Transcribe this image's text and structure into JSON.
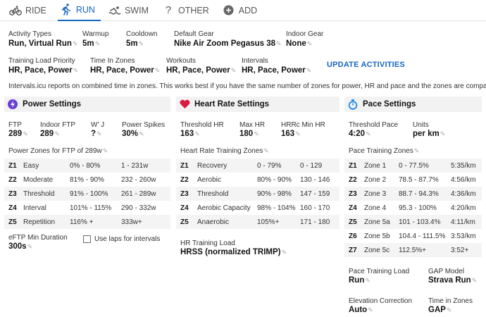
{
  "tabs": [
    {
      "label": "RIDE",
      "icon": "bike-icon"
    },
    {
      "label": "RUN",
      "icon": "run-icon",
      "active": true
    },
    {
      "label": "SWIM",
      "icon": "swim-icon"
    },
    {
      "label": "OTHER",
      "icon": "question-icon"
    },
    {
      "label": "ADD",
      "icon": "plus-circle-icon"
    }
  ],
  "settings": {
    "activity_types": {
      "label": "Activity Types",
      "value": "Run, Virtual Run"
    },
    "warmup": {
      "label": "Warmup",
      "value": "5m"
    },
    "cooldown": {
      "label": "Cooldown",
      "value": "5m"
    },
    "default_gear": {
      "label": "Default Gear",
      "value": "Nike Air Zoom Pegasus 38"
    },
    "indoor_gear": {
      "label": "Indoor Gear",
      "value": "None"
    },
    "training_load_priority": {
      "label": "Training Load Priority",
      "value": "HR, Pace, Power"
    },
    "time_in_zones": {
      "label": "Time In Zones",
      "value": "HR, Pace, Power"
    },
    "workouts": {
      "label": "Workouts",
      "value": "HR, Pace, Power"
    },
    "intervals": {
      "label": "Intervals",
      "value": "HR, Pace, Power"
    },
    "update_link": "UPDATE ACTIVITIES",
    "note": "Intervals.icu reports on combined time in zones. This works best if you have the same number of zones for power, HR and pace and the zones are comparable."
  },
  "power": {
    "title": "Power Settings",
    "accent": "#6a3fd0",
    "ftp": {
      "label": "FTP",
      "value": "289"
    },
    "indoor_ftp": {
      "label": "Indoor FTP",
      "value": "289"
    },
    "wj": {
      "label": "W' J",
      "value": "?"
    },
    "spikes": {
      "label": "Power Spikes",
      "value": "30%"
    },
    "zones_title": "Power Zones for FTP of 289w",
    "zones": [
      {
        "code": "Z1",
        "name": "Easy",
        "pct": "0% - 80%",
        "range": "1 - 231w"
      },
      {
        "code": "Z2",
        "name": "Moderate",
        "pct": "81% - 90%",
        "range": "232 - 260w"
      },
      {
        "code": "Z3",
        "name": "Threshold",
        "pct": "91% - 100%",
        "range": "261 - 289w"
      },
      {
        "code": "Z4",
        "name": "Interval",
        "pct": "101% - 115%",
        "range": "290 - 332w"
      },
      {
        "code": "Z5",
        "name": "Repetition",
        "pct": "116% +",
        "range": "333w+"
      }
    ],
    "eftp": {
      "label": "eFTP Min Duration",
      "value": "300s"
    },
    "use_laps": "Use laps for intervals"
  },
  "hr": {
    "title": "Heart Rate Settings",
    "accent": "#d81b3f",
    "threshold": {
      "label": "Threshold HR",
      "value": "163"
    },
    "max": {
      "label": "Max HR",
      "value": "180"
    },
    "hrrc": {
      "label": "HRRc Min HR",
      "value": "163"
    },
    "zones_title": "Heart Rate Training Zones",
    "zones": [
      {
        "code": "Z1",
        "name": "Recovery",
        "pct": "0 - 79%",
        "range": "0 - 129"
      },
      {
        "code": "Z2",
        "name": "Aerobic",
        "pct": "80% - 90%",
        "range": "130 - 146"
      },
      {
        "code": "Z3",
        "name": "Threshold",
        "pct": "90% - 98%",
        "range": "147 - 159"
      },
      {
        "code": "Z4",
        "name": "Aerobic Capacity",
        "pct": "98% - 104%",
        "range": "160 - 170"
      },
      {
        "code": "Z5",
        "name": "Anaerobic",
        "pct": "105%+",
        "range": "171 - 180"
      }
    ],
    "load": {
      "label": "HR Training Load",
      "value": "HRSS (normalized TRIMP)"
    }
  },
  "pace": {
    "title": "Pace Settings",
    "accent": "#1e88e5",
    "threshold": {
      "label": "Threshold Pace",
      "value": "4:20"
    },
    "units": {
      "label": "Units",
      "value": "per km"
    },
    "zones_title": "Pace Training Zones",
    "zones": [
      {
        "code": "Z1",
        "name": "Zone 1",
        "pct": "0 - 77.5%",
        "range": "5:35/km"
      },
      {
        "code": "Z2",
        "name": "Zone 2",
        "pct": "78.5 - 87.7%",
        "range": "4:56/km"
      },
      {
        "code": "Z3",
        "name": "Zone 3",
        "pct": "88.7 - 94.3%",
        "range": "4:36/km"
      },
      {
        "code": "Z4",
        "name": "Zone 4",
        "pct": "95.3 - 100%",
        "range": "4:20/km"
      },
      {
        "code": "Z5",
        "name": "Zone 5a",
        "pct": "101 - 103.4%",
        "range": "4:11/km"
      },
      {
        "code": "Z6",
        "name": "Zone 5b",
        "pct": "104.4 - 111.5%",
        "range": "3:53/km"
      },
      {
        "code": "Z7",
        "name": "Zone 5c",
        "pct": "112.5%+",
        "range": "3:52+"
      }
    ],
    "load": {
      "label": "Pace Training Load",
      "value": "Run"
    },
    "gap": {
      "label": "GAP Model",
      "value": "Strava Run"
    },
    "elevation": {
      "label": "Elevation Correction",
      "value": "Auto"
    },
    "tiz": {
      "label": "Time in Zones",
      "value": "GAP"
    }
  }
}
